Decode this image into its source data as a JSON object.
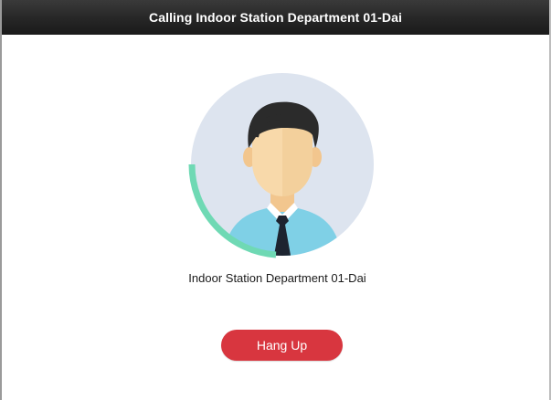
{
  "window": {
    "title": "Calling Indoor Station Department 01-Dai"
  },
  "call": {
    "callee_name": "Indoor Station Department 01-Dai",
    "avatar_icon": "user-avatar-icon",
    "ring_progress_icon": "calling-progress-ring-icon"
  },
  "actions": {
    "hangup_label": "Hang Up"
  },
  "colors": {
    "titlebar": "#262626",
    "avatar_bg": "#dde4ef",
    "progress_ring": "#6fd9b4",
    "hangup_button": "#d8363f"
  }
}
